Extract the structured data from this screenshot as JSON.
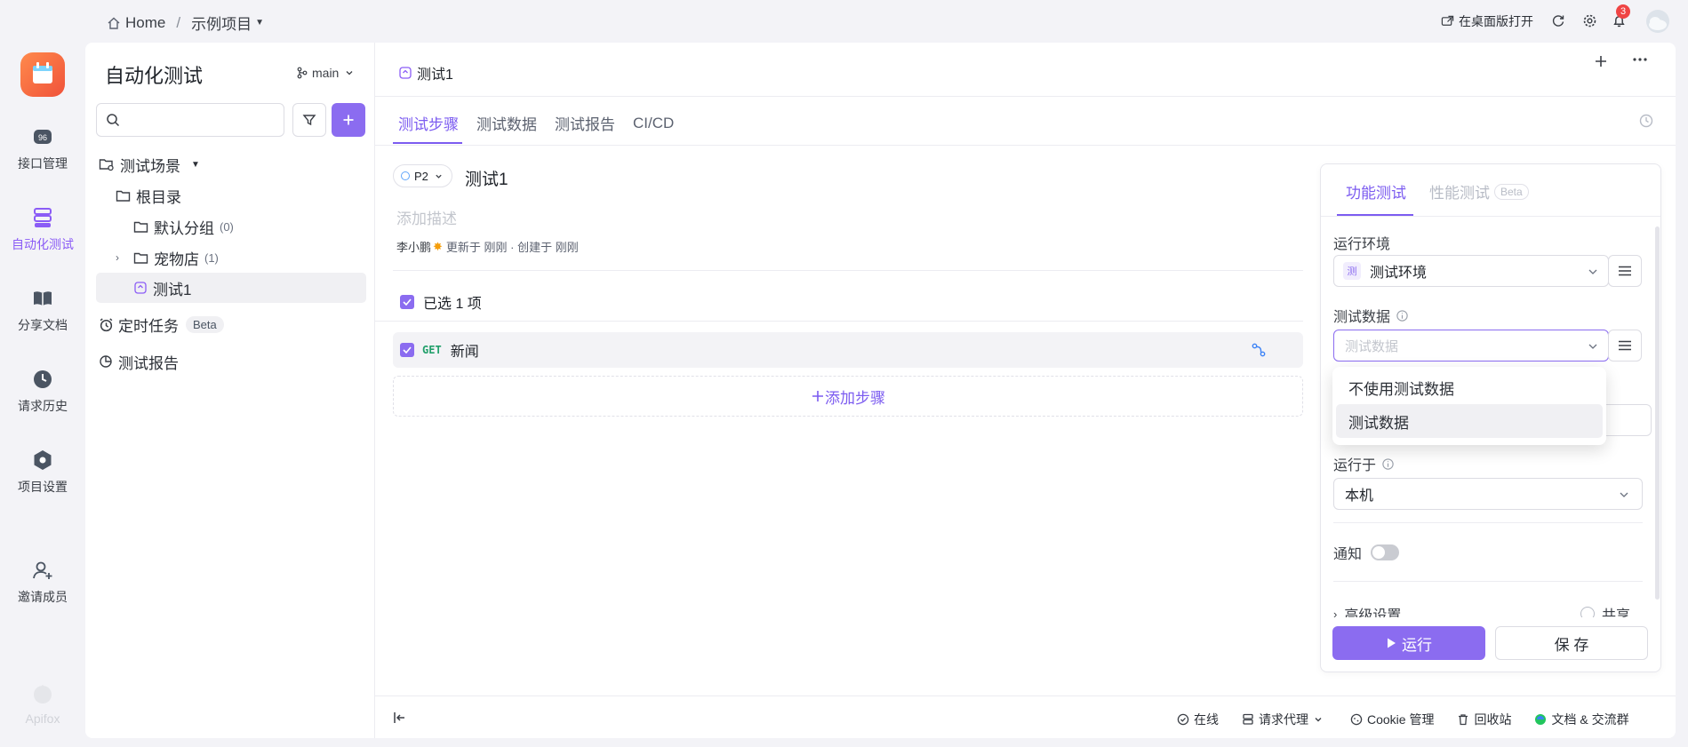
{
  "breadcrumb": {
    "home": "Home",
    "separator": "/",
    "project": "示例项目"
  },
  "topbar": {
    "open_desktop": "在桌面版打开",
    "notification_count": "3"
  },
  "rail": {
    "items": [
      {
        "label": "接口管理"
      },
      {
        "label": "自动化测试"
      },
      {
        "label": "分享文档"
      },
      {
        "label": "请求历史"
      },
      {
        "label": "项目设置"
      },
      {
        "label": "邀请成员"
      }
    ],
    "brand": "Apifox"
  },
  "tree": {
    "title": "自动化测试",
    "branch": "main",
    "search_placeholder": "",
    "items": {
      "scenes": "测试场景",
      "root": "根目录",
      "default_group": "默认分组",
      "default_group_count": "(0)",
      "pet_store": "宠物店",
      "pet_store_count": "(1)",
      "test1": "测试1",
      "scheduled": "定时任务",
      "scheduled_badge": "Beta",
      "reports": "测试报告"
    }
  },
  "doc_tab": {
    "label": "测试1"
  },
  "tabs": [
    "测试步骤",
    "测试数据",
    "测试报告",
    "CI/CD"
  ],
  "scenario": {
    "priority": "P2",
    "name": "测试1",
    "desc_placeholder": "添加描述",
    "author": "李小鹏",
    "meta": "更新于 刚刚 · 创建于 刚刚",
    "selected_text": "已选 1 项",
    "step_method": "GET",
    "step_name": "新闻",
    "add_step": "添加步骤"
  },
  "run_panel": {
    "tab_functional": "功能测试",
    "tab_performance": "性能测试",
    "tab_performance_badge": "Beta",
    "env_label": "运行环境",
    "env_badge": "测",
    "env_value": "测试环境",
    "data_label": "测试数据",
    "data_placeholder": "测试数据",
    "run_on_label": "运行于",
    "run_on_value": "本机",
    "notify_label": "通知",
    "advanced_label": "高级设置",
    "share_label": "共享",
    "run_button": "运行",
    "save_button": "保 存"
  },
  "dropdown": {
    "options": [
      "不使用测试数据",
      "测试数据"
    ],
    "selected": "测试数据"
  },
  "footer": {
    "online": "在线",
    "proxy": "请求代理",
    "cookie": "Cookie 管理",
    "trash": "回收站",
    "docs": "文档 & 交流群"
  },
  "colors": {
    "accent": "#8b5cf6",
    "brand": "#ff6a3d",
    "get_method": "#22a06b"
  }
}
